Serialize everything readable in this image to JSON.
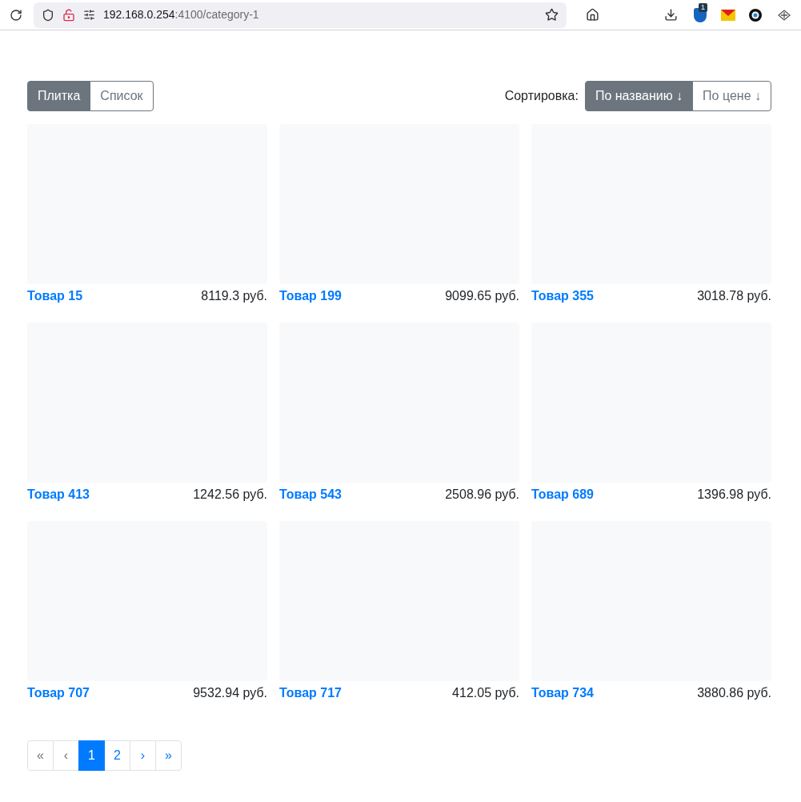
{
  "browser": {
    "url_host": "192.168.0.254",
    "url_rest": ":4100/category-1",
    "extension_badge": "1"
  },
  "view_toggle": [
    {
      "label": "Плитка",
      "selected": true
    },
    {
      "label": "Список",
      "selected": false
    }
  ],
  "sort": {
    "label": "Сортировка:",
    "options": [
      {
        "label": "По названию ↓",
        "selected": true
      },
      {
        "label": "По цене ↓",
        "selected": false
      }
    ]
  },
  "products": [
    {
      "name": "Товар 15",
      "price": "8119.3 руб."
    },
    {
      "name": "Товар 199",
      "price": "9099.65 руб."
    },
    {
      "name": "Товар 355",
      "price": "3018.78 руб."
    },
    {
      "name": "Товар 413",
      "price": "1242.56 руб."
    },
    {
      "name": "Товар 543",
      "price": "2508.96 руб."
    },
    {
      "name": "Товар 689",
      "price": "1396.98 руб."
    },
    {
      "name": "Товар 707",
      "price": "9532.94 руб."
    },
    {
      "name": "Товар 717",
      "price": "412.05 руб."
    },
    {
      "name": "Товар 734",
      "price": "3880.86 руб."
    }
  ],
  "pagination": [
    {
      "label": "«",
      "selected": false,
      "disabled": true
    },
    {
      "label": "‹",
      "selected": false,
      "disabled": true
    },
    {
      "label": "1",
      "selected": true,
      "disabled": false
    },
    {
      "label": "2",
      "selected": false,
      "disabled": false
    },
    {
      "label": "›",
      "selected": false,
      "disabled": false
    },
    {
      "label": "»",
      "selected": false,
      "disabled": false
    }
  ]
}
